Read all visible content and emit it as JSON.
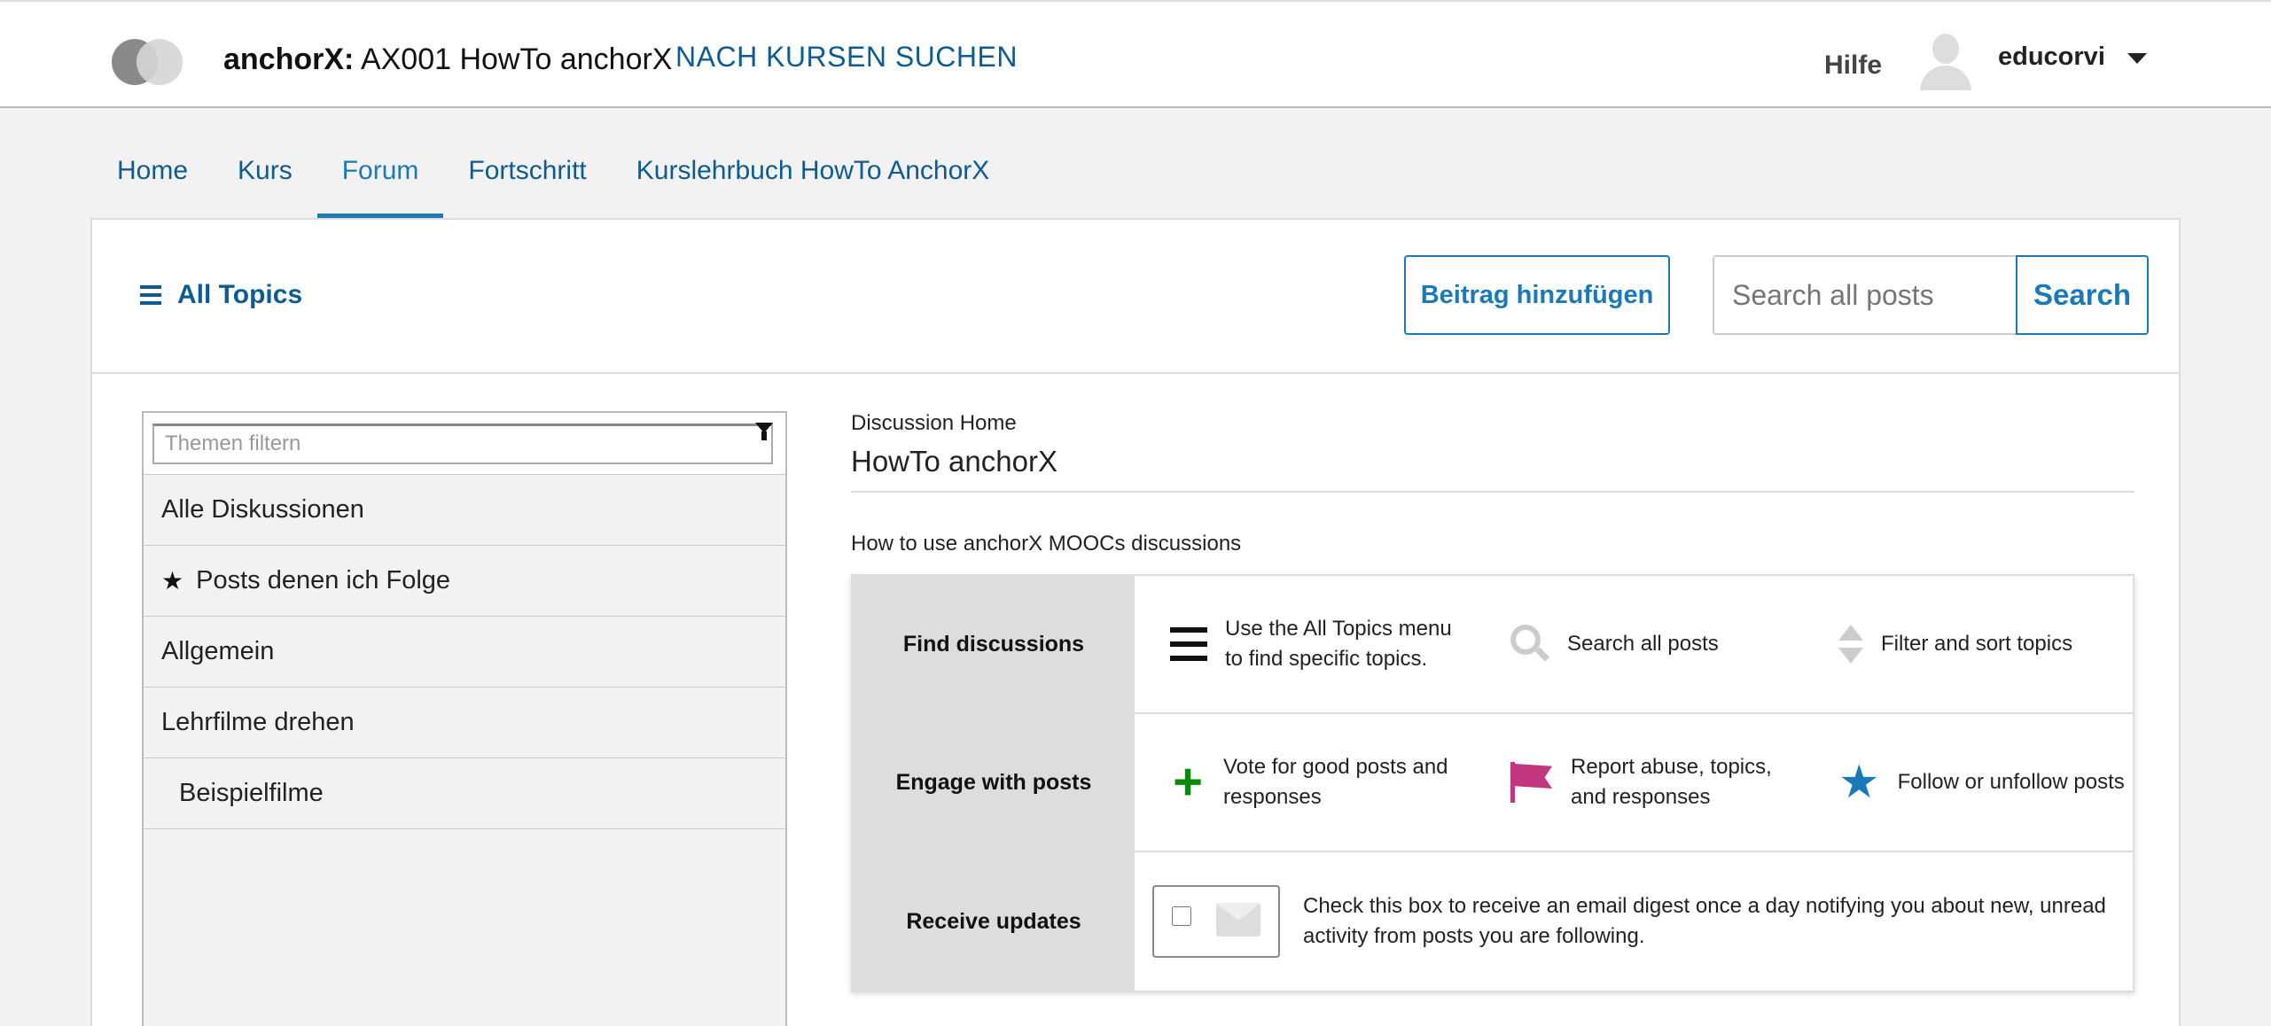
{
  "header": {
    "org": "anchorX:",
    "course": "AX001 HowTo anchorX",
    "find_courses": "NACH KURSEN SUCHEN",
    "help": "Hilfe",
    "username": "educorvi"
  },
  "tabs": [
    "Home",
    "Kurs",
    "Forum",
    "Fortschritt",
    "Kurslehrbuch HowTo AnchorX"
  ],
  "active_tab": "Forum",
  "toolbar": {
    "all_topics": "All Topics",
    "add_post": "Beitrag hinzufügen",
    "search_placeholder": "Search all posts",
    "search_button": "Search"
  },
  "sidebar": {
    "filter_placeholder": "Themen filtern",
    "topics": [
      "Alle Diskussionen",
      "Posts denen ich Folge",
      "Allgemein",
      "Lehrfilme drehen",
      "Beispielfilme"
    ]
  },
  "main": {
    "breadcrumb": "Discussion Home",
    "title": "HowTo anchorX",
    "guide_label": "How to use anchorX MOOCs discussions",
    "rows": [
      {
        "heading": "Find discussions",
        "items": [
          {
            "icon": "menu-icon",
            "text": "Use the All Topics menu to find specific topics."
          },
          {
            "icon": "search-icon",
            "text": "Search all posts"
          },
          {
            "icon": "sort-icon",
            "text": "Filter and sort topics"
          }
        ]
      },
      {
        "heading": "Engage with posts",
        "items": [
          {
            "icon": "plus-icon",
            "text": "Vote for good posts and responses"
          },
          {
            "icon": "flag-icon",
            "text": "Report abuse, topics, and responses"
          },
          {
            "icon": "star-icon",
            "text": "Follow or unfollow posts"
          }
        ]
      },
      {
        "heading": "Receive updates",
        "text": "Check this box to receive an email digest once a day notifying you about new, unread activity from posts you are following."
      }
    ]
  },
  "colors": {
    "link": "#0e5c8f",
    "accent": "#1b79b8",
    "vote": "#0a8a0a",
    "report": "#c2367f"
  }
}
